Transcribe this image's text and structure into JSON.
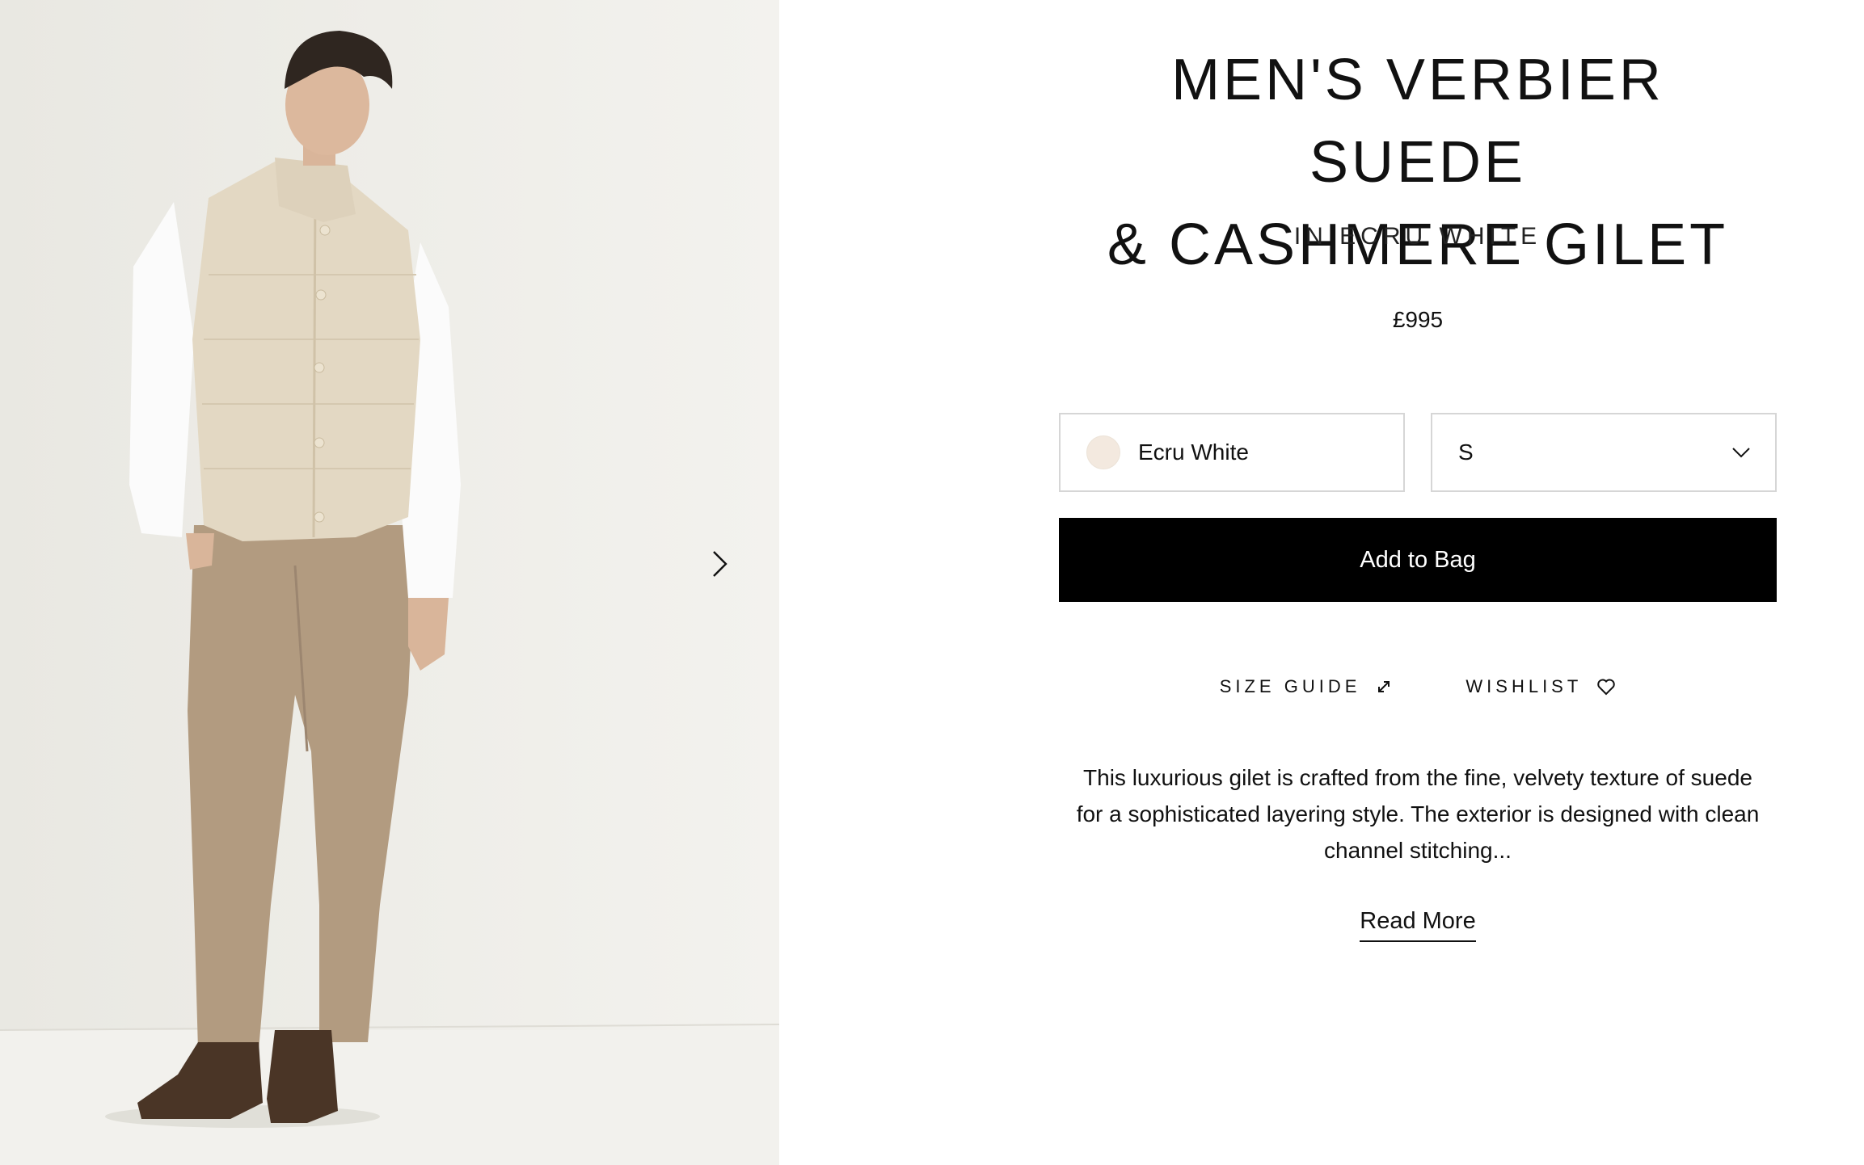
{
  "product": {
    "title_line1": "MEN'S VERBIER SUEDE",
    "title_line2": "& CASHMERE GILET",
    "subtitle": "IN ECRU WHITE",
    "price": "£995",
    "image_alt": "Model wearing the ecru white suede and cashmere gilet with beige trousers"
  },
  "selectors": {
    "color": {
      "label": "Ecru White",
      "swatch_color": "#f3e9df"
    },
    "size": {
      "value": "S"
    }
  },
  "actions": {
    "add_to_bag": "Add to Bag",
    "size_guide": "SIZE GUIDE",
    "wishlist": "WISHLIST",
    "read_more": "Read More"
  },
  "description": "This luxurious gilet is crafted from the fine, velvety texture of suede for a sophisticated layering style. The exterior is designed with clean channel stitching...",
  "icons": {
    "next": "chevron-right-icon",
    "size_select": "chevron-down-icon",
    "size_guide": "resize-arrows-icon",
    "wishlist": "heart-icon"
  },
  "colors": {
    "button_bg": "#000000",
    "gallery_bg": "#efeee9",
    "border": "#d6d6d6"
  }
}
